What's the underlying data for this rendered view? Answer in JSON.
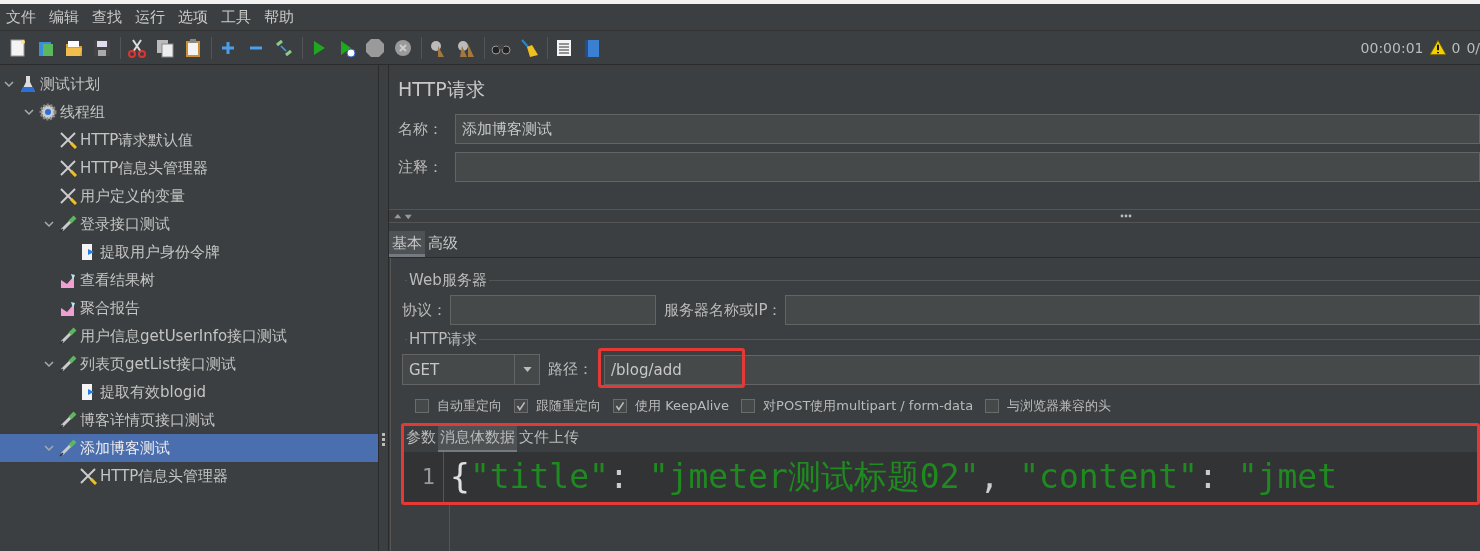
{
  "menu": [
    "文件",
    "编辑",
    "查找",
    "运行",
    "选项",
    "工具",
    "帮助"
  ],
  "status": {
    "elapsed": "00:00:01",
    "warnings": "0",
    "threads": "0/"
  },
  "tree": [
    {
      "label": "测试计划",
      "kind": "test-plan",
      "expanded": true,
      "selected": false,
      "children": [
        {
          "label": "线程组",
          "kind": "thread-group",
          "expanded": true,
          "selected": false,
          "children": [
            {
              "label": "HTTP请求默认值",
              "kind": "config",
              "selected": false
            },
            {
              "label": "HTTP信息头管理器",
              "kind": "config",
              "selected": false
            },
            {
              "label": "用户定义的变量",
              "kind": "config",
              "selected": false
            },
            {
              "label": "登录接口测试",
              "kind": "sampler",
              "expanded": true,
              "selected": false,
              "children": [
                {
                  "label": "提取用户身份令牌",
                  "kind": "post-processor",
                  "selected": false
                }
              ]
            },
            {
              "label": "查看结果树",
              "kind": "listener",
              "selected": false
            },
            {
              "label": "聚合报告",
              "kind": "listener",
              "selected": false
            },
            {
              "label": "用户信息getUserInfo接口测试",
              "kind": "sampler",
              "selected": false
            },
            {
              "label": "列表页getList接口测试",
              "kind": "sampler",
              "expanded": true,
              "selected": false,
              "children": [
                {
                  "label": "提取有效blogid",
                  "kind": "post-processor",
                  "selected": false
                }
              ]
            },
            {
              "label": "博客详情页接口测试",
              "kind": "sampler",
              "selected": false
            },
            {
              "label": "添加博客测试",
              "kind": "sampler",
              "expanded": true,
              "selected": true,
              "children": [
                {
                  "label": "HTTP信息头管理器",
                  "kind": "config",
                  "selected": false
                }
              ]
            }
          ]
        }
      ]
    }
  ],
  "panel": {
    "title": "HTTP请求",
    "name_label": "名称：",
    "name_value": "添加博客测试",
    "comment_label": "注释：",
    "tabs": [
      {
        "label": "基本",
        "selected": true
      },
      {
        "label": "高级",
        "selected": false
      }
    ],
    "web_server": {
      "legend": "Web服务器",
      "protocol_label": "协议：",
      "server_label": "服务器名称或IP："
    },
    "http_request": {
      "legend": "HTTP请求",
      "method": "GET",
      "path_label": "路径：",
      "path_value": "/blog/add",
      "path_highlighted": true
    },
    "options": [
      {
        "label": "自动重定向",
        "checked": false
      },
      {
        "label": "跟随重定向",
        "checked": true
      },
      {
        "label": "使用 KeepAlive",
        "checked": true
      },
      {
        "label": "对POST使用multipart / form-data",
        "checked": false
      },
      {
        "label": "与浏览器兼容的头",
        "checked": false
      }
    ],
    "body": {
      "highlighted": true,
      "tabs": [
        {
          "label": "参数",
          "selected": false
        },
        {
          "label": "消息体数据",
          "selected": true
        },
        {
          "label": "文件上传",
          "selected": false
        }
      ],
      "lines": [
        {
          "number": "1",
          "tokens": [
            {
              "kind": "brace",
              "text": "{"
            },
            {
              "kind": "string",
              "text": "\"title\""
            },
            {
              "kind": "punct",
              "text": ": "
            },
            {
              "kind": "string",
              "text": "\"jmeter测试标题02\""
            },
            {
              "kind": "punct",
              "text": ", "
            },
            {
              "kind": "string",
              "text": "\"content\""
            },
            {
              "kind": "punct",
              "text": ": "
            },
            {
              "kind": "string",
              "text": "\"jmet"
            }
          ]
        }
      ]
    }
  }
}
